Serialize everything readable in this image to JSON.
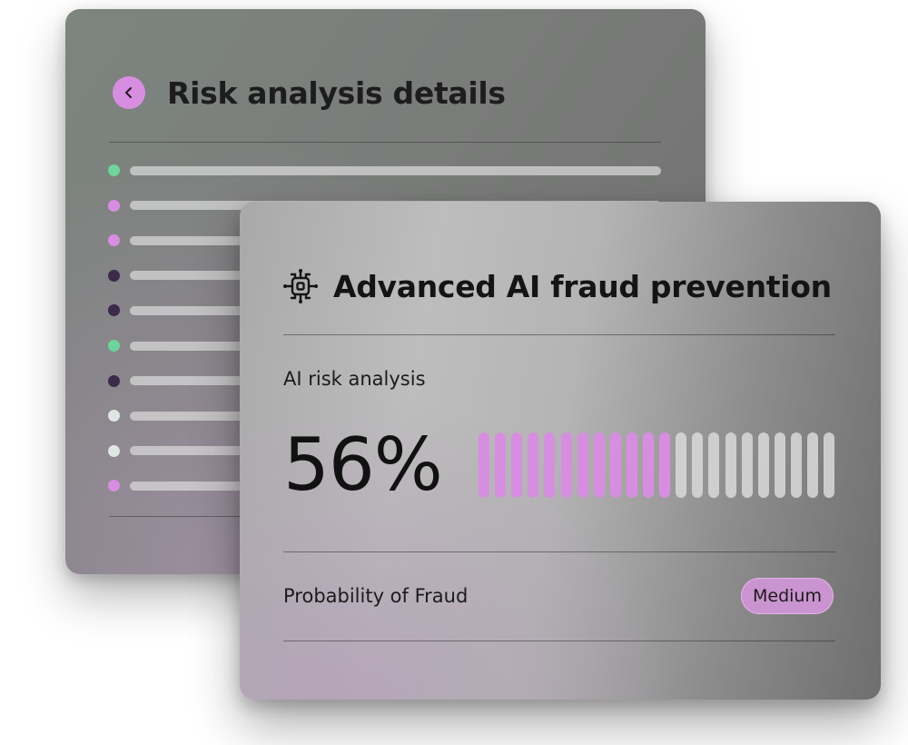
{
  "colors": {
    "accent": "#d88ee0",
    "dot_green": "#6fd49a",
    "dot_pink": "#d88ee0",
    "dot_dark": "#3b2a4a",
    "dot_white": "#dfe6e4",
    "meter_filled": "#d88ee0",
    "meter_empty": "#d9d9d9",
    "badge": "#c994cf"
  },
  "risk_details": {
    "back_icon": "chevron-left-icon",
    "title": "Risk analysis details",
    "rows": [
      {
        "dot": "green"
      },
      {
        "dot": "pink"
      },
      {
        "dot": "pink"
      },
      {
        "dot": "dark"
      },
      {
        "dot": "dark"
      },
      {
        "dot": "green"
      },
      {
        "dot": "dark"
      },
      {
        "dot": "white"
      },
      {
        "dot": "white"
      },
      {
        "dot": "pink"
      }
    ]
  },
  "fraud_card": {
    "icon": "ai-chip-icon",
    "title": "Advanced AI fraud prevention",
    "analysis_label": "AI risk analysis",
    "risk_percent_text": "56%",
    "risk_fraction": 0.56,
    "probability_label": "Probability of Fraud",
    "probability_value": "Medium"
  }
}
